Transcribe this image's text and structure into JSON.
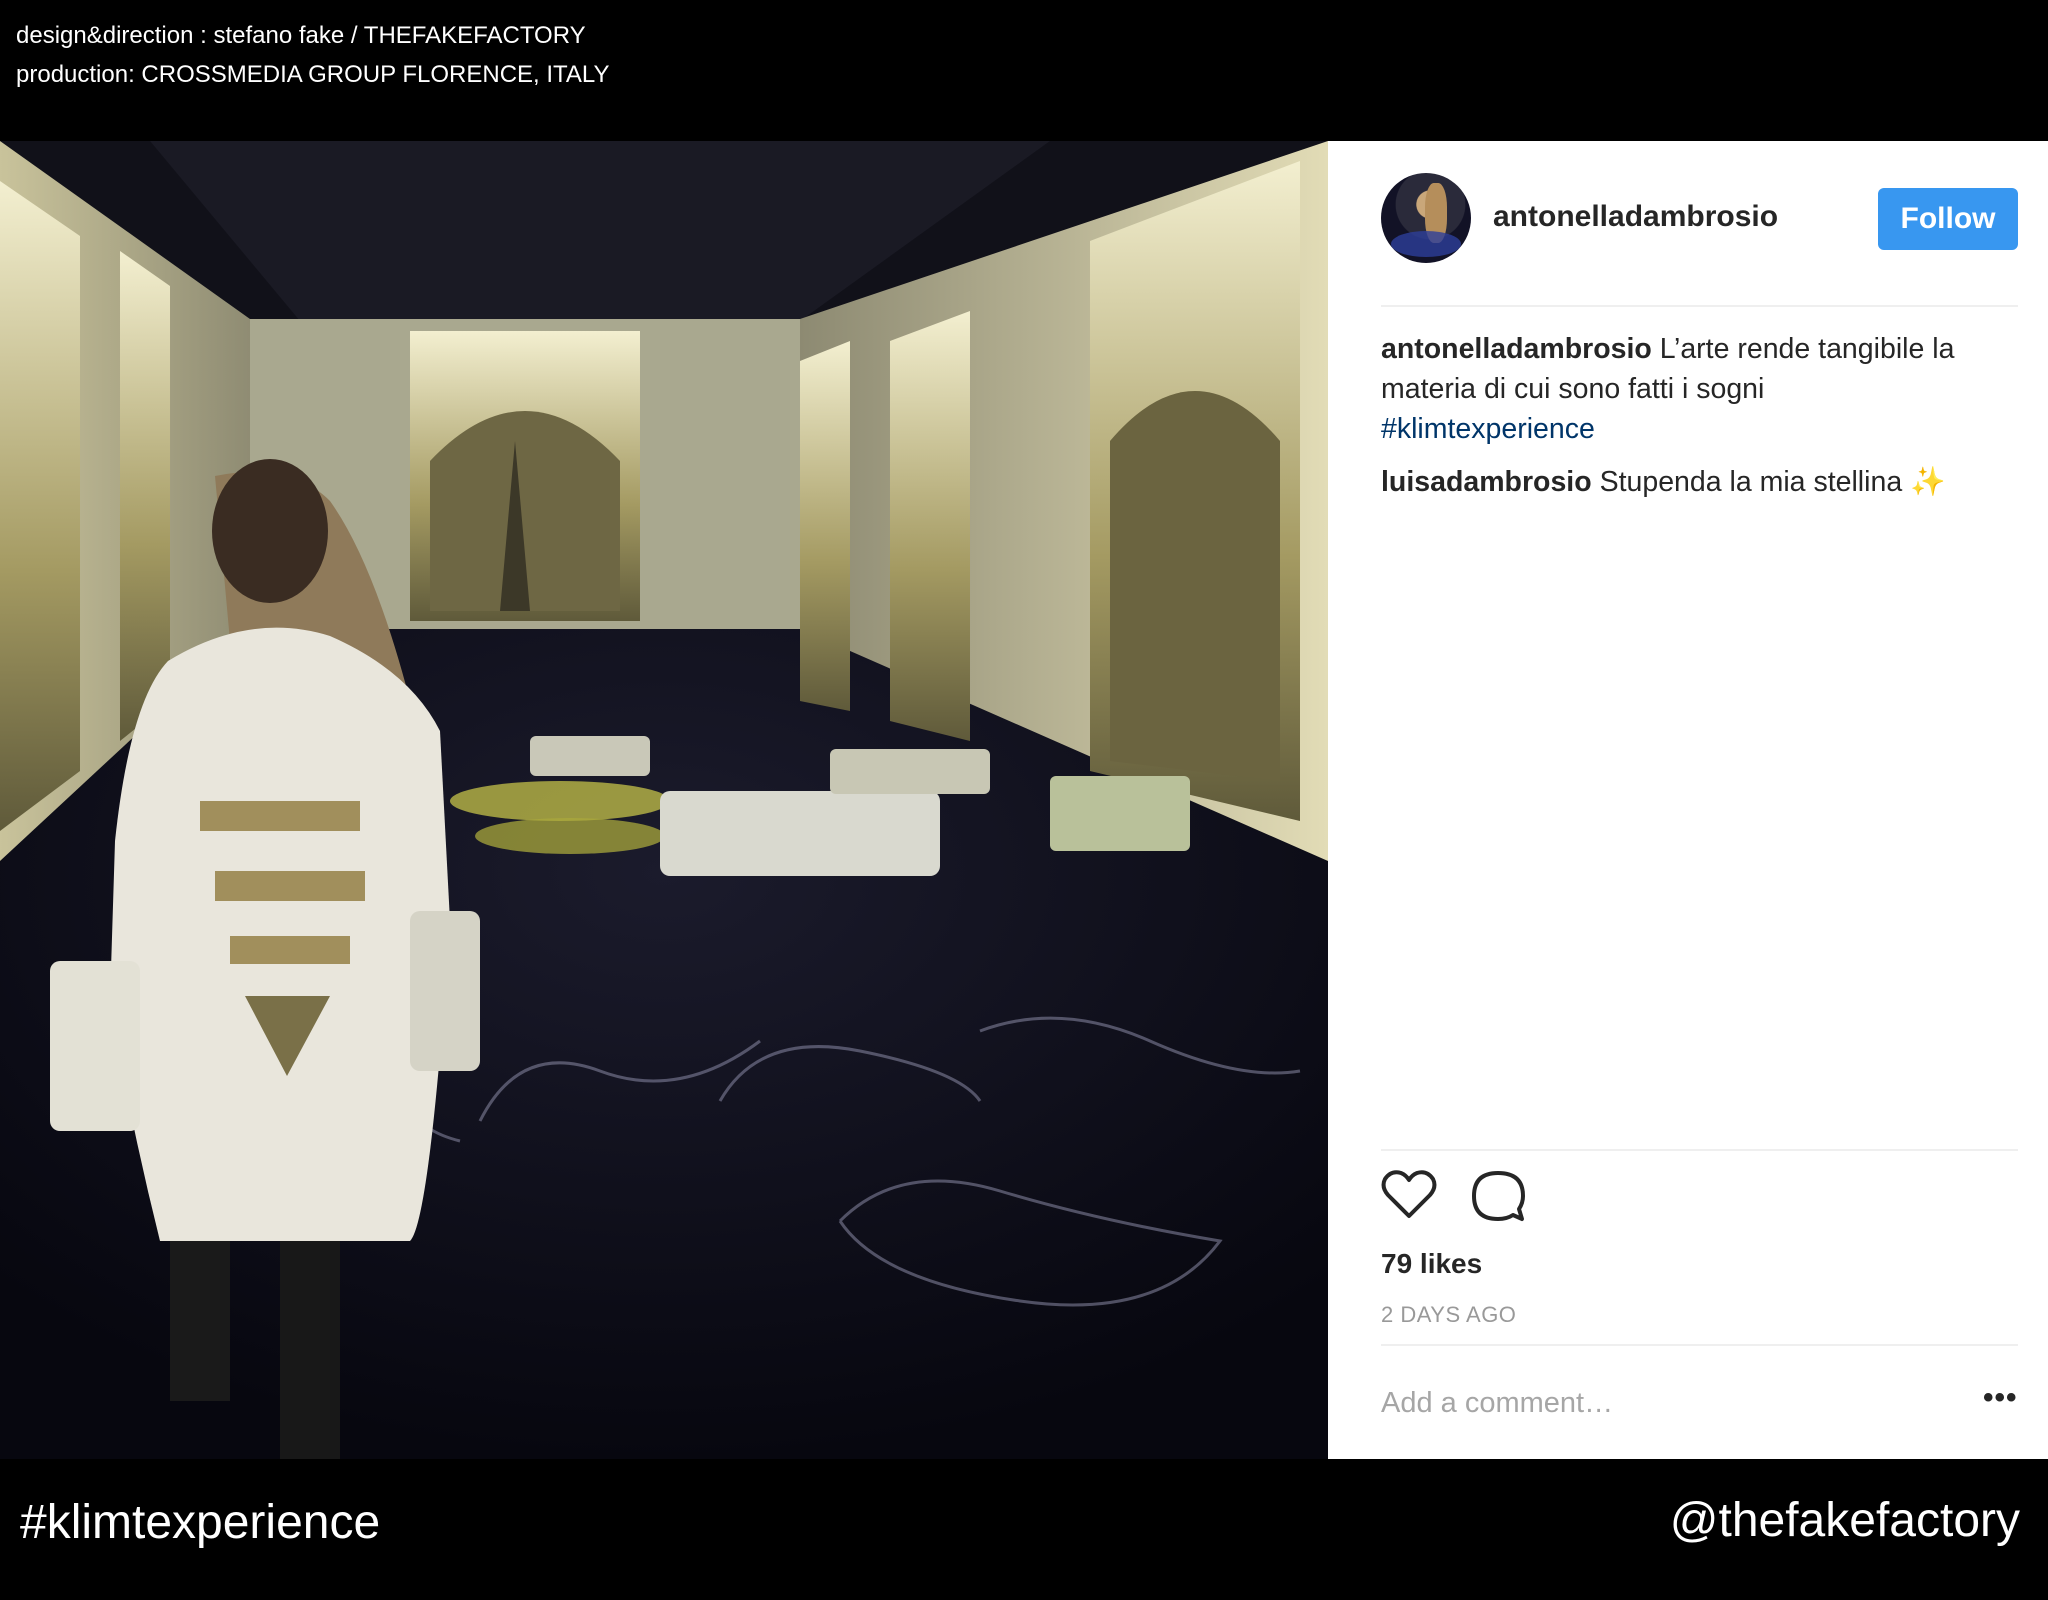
{
  "credits": {
    "line1": "design&direction : stefano fake / THEFAKEFACTORY",
    "line2": "production: CROSSMEDIA GROUP FLORENCE, ITALY"
  },
  "post": {
    "username": "antonelladambrosio",
    "follow_label": "Follow",
    "caption_user": "antonelladambrosio",
    "caption_text_1": "L’arte rende tangibile la",
    "caption_text_2": "materia di cui sono fatti i sogni",
    "caption_hashtag": "#klimtexperience",
    "comment_user": "luisadambrosio",
    "comment_text": "Stupenda la mia stellina",
    "comment_emoji": "✨",
    "likes": "79 likes",
    "time_ago": "2 DAYS AGO",
    "add_comment_placeholder": "Add a comment…",
    "more_label": "•••",
    "icons": {
      "like": "heart-icon",
      "comment": "comment-icon"
    }
  },
  "footer": {
    "hashtag": "#klimtexperience",
    "handle": "@thefakefactory"
  },
  "colors": {
    "follow_button": "#3897f0",
    "hashtag_link": "#003569",
    "text": "#262626",
    "muted": "#999999"
  }
}
